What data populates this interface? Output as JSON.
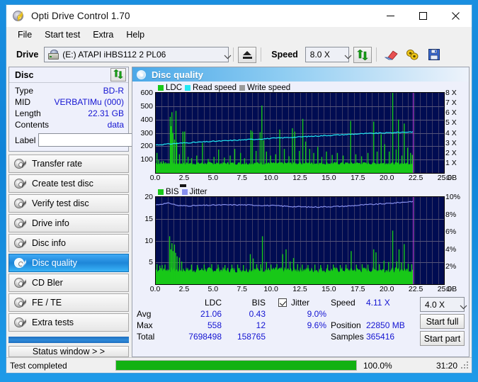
{
  "window": {
    "title": "Opti Drive Control 1.70",
    "icon": "disc-icon",
    "minimize": "minimize-icon",
    "maximize": "maximize-icon",
    "close": "close-icon"
  },
  "menu": {
    "items": [
      "File",
      "Start test",
      "Extra",
      "Help"
    ]
  },
  "toolbar": {
    "drive_label": "Drive",
    "drive_value": "(E:)   ATAPI iHBS112  2 PL06",
    "eject_icon": "eject-icon",
    "speed_label": "Speed",
    "speed_value": "8.0 X",
    "refresh_icon": "refresh-icon",
    "erase_icon": "eraser-icon",
    "pill_icon": "pill-icon",
    "save_icon": "save-icon"
  },
  "disc": {
    "header": "Disc",
    "refresh_icon": "refresh-icon",
    "rows": [
      {
        "key": "Type",
        "value": "BD-R"
      },
      {
        "key": "MID",
        "value": "VERBATIMu (000)"
      },
      {
        "key": "Length",
        "value": "22.31 GB"
      },
      {
        "key": "Contents",
        "value": "data"
      }
    ],
    "label_key": "Label",
    "label_value": "",
    "label_placeholder": "",
    "disc_button_icon": "cd-icon"
  },
  "nav": {
    "items": [
      {
        "label": "Transfer rate",
        "icon": "disc-icon",
        "active": false
      },
      {
        "label": "Create test disc",
        "icon": "disc-icon",
        "active": false
      },
      {
        "label": "Verify test disc",
        "icon": "disc-icon",
        "active": false
      },
      {
        "label": "Drive info",
        "icon": "disc-icon",
        "active": false
      },
      {
        "label": "Disc info",
        "icon": "disc-icon",
        "active": false
      },
      {
        "label": "Disc quality",
        "icon": "disc-icon",
        "active": true
      },
      {
        "label": "CD Bler",
        "icon": "disc-icon",
        "active": false
      },
      {
        "label": "FE / TE",
        "icon": "disc-icon",
        "active": false
      },
      {
        "label": "Extra tests",
        "icon": "disc-icon",
        "active": false
      }
    ],
    "status_window_button": "Status window > >"
  },
  "panel": {
    "title": "Disc quality",
    "icon": "disc-quality-icon"
  },
  "stats": {
    "col_headers": [
      "LDC",
      "BIS"
    ],
    "row_labels": [
      "Avg",
      "Max",
      "Total"
    ],
    "ldc": {
      "avg": "21.06",
      "max": "558",
      "total": "7698498"
    },
    "bis": {
      "avg": "0.43",
      "max": "12",
      "total": "158765"
    },
    "jitter": {
      "label": "Jitter",
      "checked": true,
      "avg": "9.0%",
      "max": "9.6%"
    },
    "speed_label": "Speed",
    "speed_value": "4.11 X",
    "position_label": "Position",
    "position_value": "22850 MB",
    "samples_label": "Samples",
    "samples_value": "365416",
    "speed_select": "4.0 X",
    "start_full": "Start full",
    "start_part": "Start part"
  },
  "statusbar": {
    "message": "Test completed",
    "percent_text": "100.0%",
    "percent_value": 100,
    "time": "31:20"
  },
  "colors": {
    "ldc_green": "#18c818",
    "read_speed_cyan": "#22e8f2",
    "write_speed_gray": "#9a9a9a",
    "bis_green": "#18c818",
    "jitter_blue": "#8890ee",
    "plot_bg": "#000c52",
    "marker_magenta": "#c840d8",
    "accent_blue": "#1e86d8",
    "value_text": "#1414d2",
    "progress_green": "#12b112"
  },
  "chart_data": [
    {
      "type": "line",
      "name": "disc-quality-ldc",
      "title": "",
      "xlabel": "GB",
      "ylabel": "LDC",
      "legend": [
        {
          "label": "LDC",
          "color": "#18c818"
        },
        {
          "label": "Read speed",
          "color": "#22e8f2"
        },
        {
          "label": "Write speed",
          "color": "#9a9a9a"
        }
      ],
      "legend_position": "top-left",
      "grid": true,
      "xlim": [
        0,
        25
      ],
      "xticks": [
        0.0,
        2.5,
        5.0,
        7.5,
        10.0,
        12.5,
        15.0,
        17.5,
        20.0,
        22.5,
        25.0
      ],
      "xtick_labels": [
        "0.0",
        "2.5",
        "5.0",
        "7.5",
        "10.0",
        "12.5",
        "15.0",
        "17.5",
        "20.0",
        "22.5",
        "25.0"
      ],
      "ylim": [
        0,
        600
      ],
      "yticks": [
        100,
        200,
        300,
        400,
        500,
        600
      ],
      "ytick_labels": [
        "100",
        "200",
        "300",
        "400",
        "500",
        "600"
      ],
      "y2lim": [
        0,
        8
      ],
      "y2ticks": [
        1,
        2,
        3,
        4,
        5,
        6,
        7,
        8
      ],
      "y2tick_labels": [
        "1 X",
        "2 X",
        "3 X",
        "4 X",
        "5 X",
        "6 X",
        "7 X",
        "8 X"
      ],
      "data_end_x": 22.31,
      "marker_x": 22.31,
      "series": [
        {
          "name": "LDC",
          "color": "#18c818",
          "kind": "spikes",
          "baseline": 60,
          "noise": 22,
          "spikes": [
            [
              0.1,
              150
            ],
            [
              0.25,
              95
            ],
            [
              0.45,
              85
            ],
            [
              0.65,
              90
            ],
            [
              0.85,
              80
            ],
            [
              1.25,
              420
            ],
            [
              1.32,
              350
            ],
            [
              1.4,
              455
            ],
            [
              1.48,
              300
            ],
            [
              1.62,
              250
            ],
            [
              1.75,
              465
            ],
            [
              1.82,
              230
            ],
            [
              2.05,
              140
            ],
            [
              2.35,
              310
            ],
            [
              2.5,
              310
            ],
            [
              2.8,
              120
            ],
            [
              3.1,
              110
            ],
            [
              3.55,
              130
            ],
            [
              4.05,
              225
            ],
            [
              4.55,
              105
            ],
            [
              5.05,
              120
            ],
            [
              5.45,
              175
            ],
            [
              5.95,
              115
            ],
            [
              6.45,
              130
            ],
            [
              6.85,
              180
            ],
            [
              7.35,
              150
            ],
            [
              7.7,
              110
            ],
            [
              8.25,
              320
            ],
            [
              8.38,
              310
            ],
            [
              8.7,
              165
            ],
            [
              9.05,
              305
            ],
            [
              9.2,
              505
            ],
            [
              9.35,
              245
            ],
            [
              9.6,
              160
            ],
            [
              9.95,
              130
            ],
            [
              10.4,
              140
            ],
            [
              10.75,
              325
            ],
            [
              11.15,
              180
            ],
            [
              11.55,
              125
            ],
            [
              11.85,
              335
            ],
            [
              12.05,
              310
            ],
            [
              12.45,
              165
            ],
            [
              12.75,
              405
            ],
            [
              13.0,
              235
            ],
            [
              13.35,
              180
            ],
            [
              13.7,
              150
            ],
            [
              14.05,
              195
            ],
            [
              14.4,
              120
            ],
            [
              14.8,
              160
            ],
            [
              15.3,
              135
            ],
            [
              15.75,
              150
            ],
            [
              16.25,
              130
            ],
            [
              16.9,
              390
            ],
            [
              17.35,
              140
            ],
            [
              17.85,
              125
            ],
            [
              18.4,
              150
            ],
            [
              18.9,
              385
            ],
            [
              19.2,
              160
            ],
            [
              19.55,
              290
            ],
            [
              19.85,
              215
            ],
            [
              20.25,
              160
            ],
            [
              20.55,
              715
            ],
            [
              20.85,
              175
            ],
            [
              21.05,
              400
            ],
            [
              21.35,
              130
            ],
            [
              21.55,
              370
            ],
            [
              21.85,
              190
            ],
            [
              22.1,
              150
            ],
            [
              22.25,
              135
            ]
          ]
        },
        {
          "name": "Read speed",
          "color": "#22e8f2",
          "kind": "line",
          "points": [
            [
              0.0,
              2.8
            ],
            [
              2.5,
              3.0
            ],
            [
              5.0,
              3.15
            ],
            [
              7.5,
              3.3
            ],
            [
              10.0,
              3.45
            ],
            [
              12.5,
              3.6
            ],
            [
              15.0,
              3.75
            ],
            [
              17.5,
              3.9
            ],
            [
              20.0,
              4.0
            ],
            [
              22.31,
              4.11
            ]
          ]
        }
      ]
    },
    {
      "type": "line",
      "name": "disc-quality-bis",
      "title": "",
      "xlabel": "GB",
      "ylabel": "BIS",
      "legend": [
        {
          "label": "BIS",
          "color": "#18c818"
        },
        {
          "label": "Jitter",
          "color": "#8890ee"
        }
      ],
      "legend_position": "top-left",
      "grid": true,
      "xlim": [
        0,
        25
      ],
      "xticks": [
        0.0,
        2.5,
        5.0,
        7.5,
        10.0,
        12.5,
        15.0,
        17.5,
        20.0,
        22.5,
        25.0
      ],
      "xtick_labels": [
        "0.0",
        "2.5",
        "5.0",
        "7.5",
        "10.0",
        "12.5",
        "15.0",
        "17.5",
        "20.0",
        "22.5",
        "25.0"
      ],
      "ylim": [
        0,
        20
      ],
      "yticks": [
        5,
        10,
        15,
        20
      ],
      "ytick_labels": [
        "5",
        "10",
        "15",
        "20"
      ],
      "y2lim": [
        0,
        10
      ],
      "y2ticks": [
        2,
        4,
        6,
        8,
        10
      ],
      "y2tick_labels": [
        "2%",
        "4%",
        "6%",
        "8%",
        "10%"
      ],
      "data_end_x": 22.31,
      "marker_x": 22.31,
      "series": [
        {
          "name": "BIS",
          "color": "#18c818",
          "kind": "spikes",
          "baseline": 2.6,
          "noise": 1.3,
          "spikes": [
            [
              0.1,
              4.6
            ],
            [
              0.35,
              4.3
            ],
            [
              0.55,
              4.4
            ],
            [
              0.8,
              4.5
            ],
            [
              1.2,
              11.0
            ],
            [
              1.3,
              8.0
            ],
            [
              1.4,
              9.4
            ],
            [
              1.5,
              7.6
            ],
            [
              1.62,
              9.1
            ],
            [
              1.72,
              7.2
            ],
            [
              1.85,
              6.4
            ],
            [
              2.05,
              6.1
            ],
            [
              2.25,
              5.2
            ],
            [
              3.1,
              4.5
            ],
            [
              3.6,
              4.4
            ],
            [
              4.2,
              4.5
            ],
            [
              4.85,
              4.6
            ],
            [
              5.4,
              4.5
            ],
            [
              6.0,
              4.4
            ],
            [
              6.6,
              4.5
            ],
            [
              7.1,
              4.5
            ],
            [
              7.6,
              4.4
            ],
            [
              8.2,
              6.9
            ],
            [
              8.45,
              5.9
            ],
            [
              8.75,
              4.6
            ],
            [
              9.1,
              4.6
            ],
            [
              9.25,
              11.0
            ],
            [
              9.6,
              5.1
            ],
            [
              10.0,
              4.5
            ],
            [
              10.5,
              4.6
            ],
            [
              11.0,
              6.9
            ],
            [
              11.3,
              8.0
            ],
            [
              11.65,
              5.2
            ],
            [
              11.95,
              6.0
            ],
            [
              12.3,
              4.6
            ],
            [
              12.7,
              4.5
            ],
            [
              13.2,
              4.4
            ],
            [
              13.8,
              4.5
            ],
            [
              14.3,
              4.4
            ],
            [
              14.9,
              4.5
            ],
            [
              15.4,
              4.5
            ],
            [
              16.0,
              4.4
            ],
            [
              16.5,
              4.5
            ],
            [
              16.95,
              7.6
            ],
            [
              17.4,
              4.5
            ],
            [
              17.9,
              4.6
            ],
            [
              18.4,
              4.5
            ],
            [
              18.9,
              8.0
            ],
            [
              19.1,
              7.3
            ],
            [
              19.4,
              4.6
            ],
            [
              19.8,
              5.4
            ],
            [
              20.2,
              5.1
            ],
            [
              20.55,
              12.3
            ],
            [
              20.9,
              5.2
            ],
            [
              21.1,
              8.0
            ],
            [
              21.3,
              5.0
            ],
            [
              21.55,
              9.2
            ],
            [
              21.9,
              4.7
            ],
            [
              22.2,
              4.6
            ]
          ]
        },
        {
          "name": "Jitter",
          "color": "#8890ee",
          "kind": "line",
          "points": [
            [
              0.0,
              9.1
            ],
            [
              0.5,
              9.2
            ],
            [
              1.2,
              9.3
            ],
            [
              2.0,
              9.0
            ],
            [
              3.0,
              9.0
            ],
            [
              4.5,
              9.05
            ],
            [
              6.0,
              9.1
            ],
            [
              7.5,
              9.1
            ],
            [
              9.0,
              9.05
            ],
            [
              10.5,
              9.0
            ],
            [
              12.0,
              8.9
            ],
            [
              13.5,
              8.85
            ],
            [
              15.0,
              8.9
            ],
            [
              16.5,
              8.95
            ],
            [
              18.0,
              9.1
            ],
            [
              19.5,
              9.2
            ],
            [
              21.0,
              9.35
            ],
            [
              22.31,
              9.5
            ]
          ]
        }
      ]
    }
  ]
}
